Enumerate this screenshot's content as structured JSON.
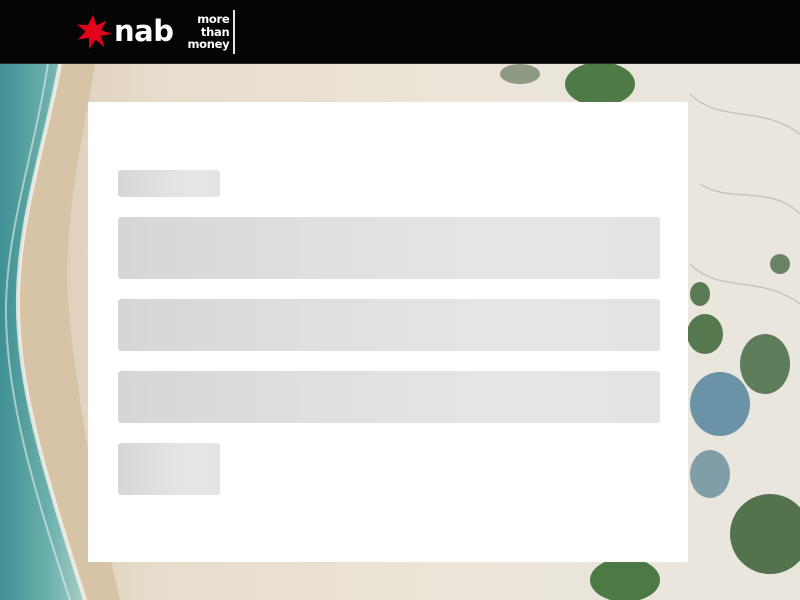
{
  "header": {
    "brand": {
      "logo_icon": "red-star-icon",
      "name": "nab",
      "tagline_lines": [
        "more",
        "than",
        "money"
      ],
      "colors": {
        "star": "#e2001a",
        "text": "#ffffff",
        "bar": "#050505"
      }
    }
  },
  "background": {
    "description_icon": "aerial-beach-image",
    "colors": {
      "sea": "#5fa3a4",
      "sand": "#e8ddd0",
      "dune": "#e6e3dc",
      "vegetation": "#5d7c59"
    }
  },
  "login_card": {
    "state": "loading-skeleton",
    "colors": {
      "card": "#ffffff",
      "skeleton": "#dcdcdc"
    }
  }
}
